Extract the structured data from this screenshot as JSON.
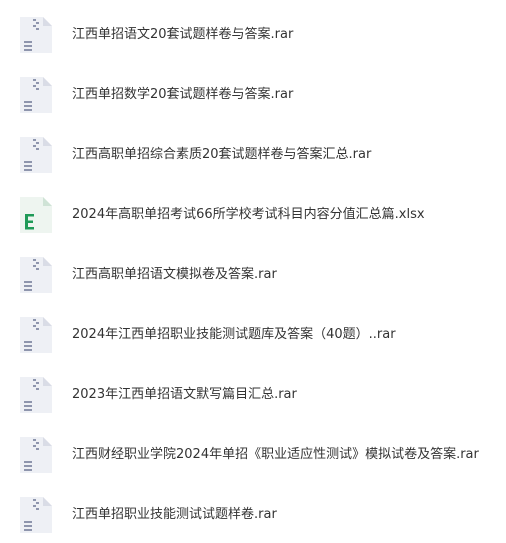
{
  "files": [
    {
      "name": "江西单招语文20套试题样卷与答案.rar",
      "type": "rar",
      "icon": "archive-file-icon"
    },
    {
      "name": "江西单招数学20套试题样卷与答案.rar",
      "type": "rar",
      "icon": "archive-file-icon"
    },
    {
      "name": "江西高职单招综合素质20套试题样卷与答案汇总.rar",
      "type": "rar",
      "icon": "archive-file-icon"
    },
    {
      "name": "2024年高职单招考试66所学校考试科目内容分值汇总篇.xlsx",
      "type": "xlsx",
      "icon": "excel-file-icon"
    },
    {
      "name": "江西高职单招语文模拟卷及答案.rar",
      "type": "rar",
      "icon": "archive-file-icon"
    },
    {
      "name": "2024年江西单招职业技能测试题库及答案（40题）..rar",
      "type": "rar",
      "icon": "archive-file-icon"
    },
    {
      "name": "2023年江西单招语文默写篇目汇总.rar",
      "type": "rar",
      "icon": "archive-file-icon"
    },
    {
      "name": "江西财经职业学院2024年单招《职业适应性测试》模拟试卷及答案.rar",
      "type": "rar",
      "icon": "archive-file-icon"
    },
    {
      "name": "江西单招职业技能测试试题样卷.rar",
      "type": "rar",
      "icon": "archive-file-icon"
    }
  ],
  "colors": {
    "archive_icon_body": "#eef0f5",
    "archive_icon_fold": "#d9dce6",
    "archive_icon_mark": "#8e95ad",
    "excel_icon_body": "#eef5f0",
    "excel_icon_fold": "#cfe3d6",
    "excel_icon_mark": "#1f9a57",
    "text": "#333333"
  }
}
